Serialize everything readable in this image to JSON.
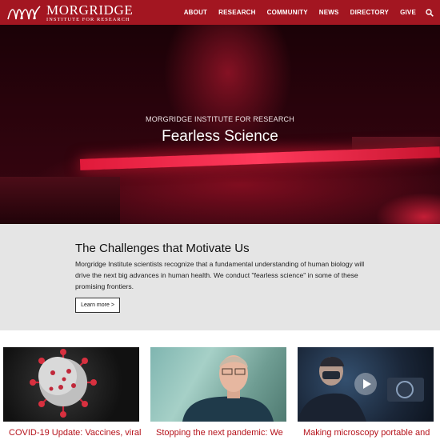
{
  "header": {
    "logo_name": "MORGRIDGE",
    "logo_sub": "INSTITUTE FOR RESEARCH",
    "nav": [
      "ABOUT",
      "RESEARCH",
      "COMMUNITY",
      "NEWS",
      "DIRECTORY",
      "GIVE"
    ],
    "search_icon": "search-icon",
    "brand_color": "#a31621"
  },
  "hero": {
    "eyebrow": "MORGRIDGE INSTITUTE FOR RESEARCH",
    "title": "Fearless Science"
  },
  "challenges": {
    "heading": "The Challenges that Motivate Us",
    "body": "Morgridge Institute scientists recognize that a fundamental understanding of human biology will drive the next big advances in human health. We conduct \"fearless science\" in some of these promising frontiers.",
    "button": "Learn more >"
  },
  "cards": [
    {
      "title": "COVID-19 Update: Vaccines, viral"
    },
    {
      "title": "Stopping the next pandemic: We"
    },
    {
      "title": "Making microscopy portable and",
      "icon": "play-icon"
    }
  ],
  "colors": {
    "accent": "#b5121b",
    "panel": "#e5e5e5"
  }
}
